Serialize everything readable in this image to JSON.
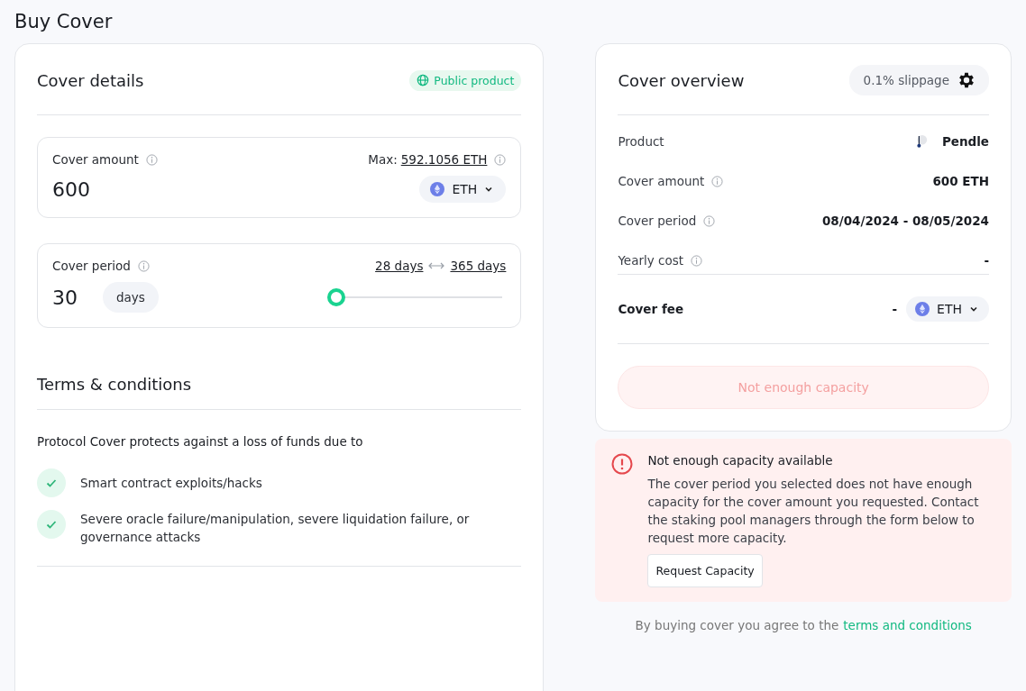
{
  "page_title": "Buy Cover",
  "cover_details": {
    "title": "Cover details",
    "badge": "Public product",
    "amount": {
      "label": "Cover amount",
      "max_label": "Max:",
      "max_value": "592.1056 ETH",
      "value": "600",
      "currency": "ETH"
    },
    "period": {
      "label": "Cover period",
      "min": "28 days",
      "max": "365 days",
      "value": "30",
      "unit": "days",
      "level": 0.006
    }
  },
  "terms": {
    "title": "Terms & conditions",
    "intro": "Protocol Cover protects against a loss of funds due to",
    "items": [
      {
        "text": "Smart contract exploits/hacks"
      },
      {
        "text": "Severe oracle failure/manipulation, severe liquidation failure, or governance attacks"
      }
    ]
  },
  "overview": {
    "title": "Cover overview",
    "slippage": "0.1% slippage",
    "rows": [
      {
        "kind": "product",
        "label": "Product",
        "value": "Pendle"
      },
      {
        "kind": "plain",
        "label": "Cover amount",
        "value": "600  ETH",
        "info": true
      },
      {
        "kind": "plain",
        "label": "Cover period",
        "value": "08/04/2024 - 08/05/2024",
        "info": true
      },
      {
        "kind": "plain",
        "label": "Yearly cost",
        "value": "-",
        "info": true
      }
    ],
    "fee": {
      "label": "Cover fee",
      "value": "-",
      "currency": "ETH"
    },
    "action": {
      "label": "Not enough capacity",
      "disabled": true
    }
  },
  "alert": {
    "title": "Not enough capacity available",
    "message": "The cover period you selected does not have enough capacity for the cover amount you requested. Contact the staking pool managers through the form below to request more capacity.",
    "button": "Request Capacity"
  },
  "footer": {
    "text": "By buying cover you agree to the",
    "link": "terms and conditions"
  }
}
